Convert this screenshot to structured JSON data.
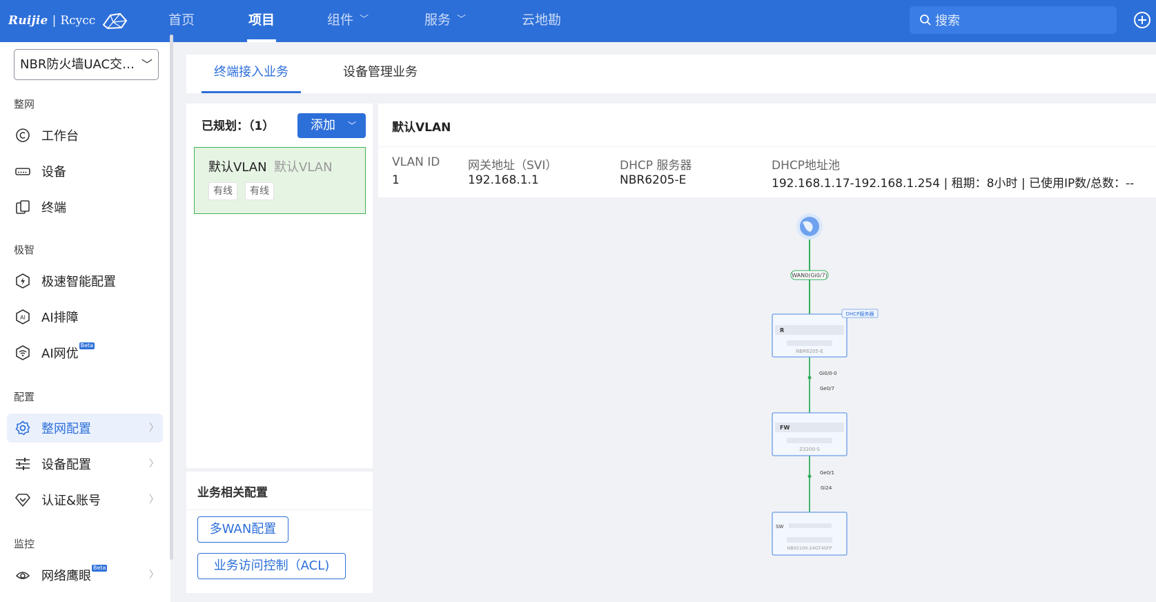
{
  "header": {
    "logo_brand": "Ruijie",
    "logo_separator": "|",
    "logo_sub": "Rcycc",
    "nav": [
      "首页",
      "项目",
      "组件",
      "服务",
      "云地勘"
    ],
    "search_placeholder": "搜索"
  },
  "sidebar": {
    "project": "NBR防火墙UAC交…",
    "groups": {
      "network": "整网",
      "smart": "极智",
      "config": "配置",
      "monitor": "监控"
    },
    "items": {
      "workbench": "工作台",
      "devices": "设备",
      "terminals": "终端",
      "fast_config": "极速智能配置",
      "ai_diagnose": "AI排障",
      "ai_optimize": "AI网优",
      "network_config": "整网配置",
      "device_config": "设备配置",
      "auth_account": "认证&账号",
      "eagle_eye": "网络鹰眼"
    },
    "beta": "Beta"
  },
  "tabs": [
    "终端接入业务",
    "设备管理业务"
  ],
  "vlan_list": {
    "planned_label": "已规划：（1）",
    "add_button": "添加",
    "card": {
      "name": "默认VLAN",
      "alias": "默认VLAN",
      "tags": [
        "有线",
        "有线"
      ]
    }
  },
  "related_config": {
    "title": "业务相关配置",
    "buttons": [
      "多WAN配置",
      "业务访问控制（ACL)"
    ]
  },
  "detail": {
    "title": "默认VLAN",
    "columns": [
      {
        "header": "VLAN ID",
        "value": "1"
      },
      {
        "header": "网关地址（SVI）",
        "value": "192.168.1.1"
      },
      {
        "header": "DHCP 服务器",
        "value": "NBR6205-E"
      },
      {
        "header": "DHCP地址池",
        "value": "192.168.1.17-192.168.1.254  |  租期：8小时  |  已使用IP数/总数：--"
      }
    ]
  },
  "topology": {
    "wan_label": "WAN0(Gi0/7)",
    "dhcp_badge": "DHCP服务器",
    "devices": [
      {
        "role": "R",
        "model": "NBR6205-E"
      },
      {
        "role": "FW",
        "model": "Z3200-S"
      },
      {
        "role": "SW",
        "model": "NBS5100-24GT4SFP"
      }
    ],
    "links": [
      {
        "upper_port": "Gi0/0-0",
        "lower_port": "Ge0/7"
      },
      {
        "upper_port": "Ge0/1",
        "lower_port": "Gi24"
      }
    ],
    "colors": {
      "accent": "#2d6fd9",
      "link": "#2fae5b",
      "card_green": "#e6f4e4"
    }
  }
}
